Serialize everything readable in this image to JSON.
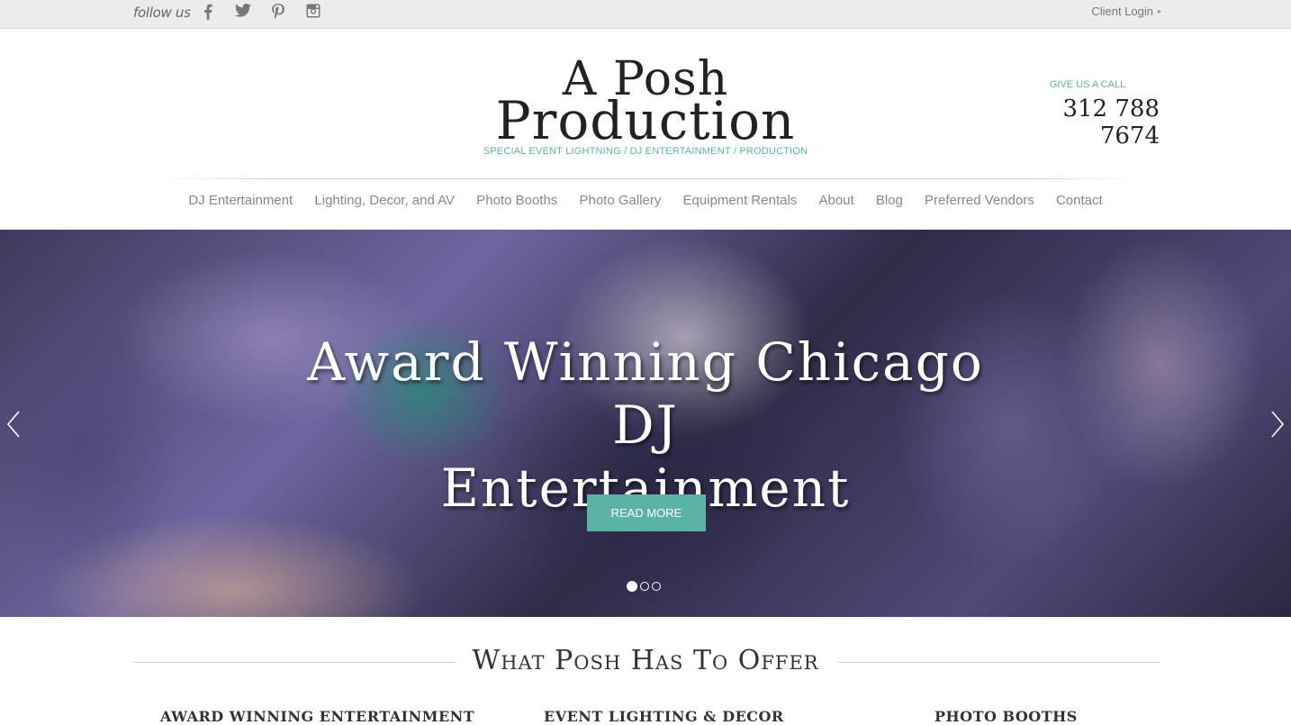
{
  "topbar": {
    "follow_label": "follow us",
    "social": [
      {
        "name": "facebook",
        "icon": "facebook-icon"
      },
      {
        "name": "twitter",
        "icon": "twitter-icon"
      },
      {
        "name": "pinterest",
        "icon": "pinterest-icon"
      },
      {
        "name": "instagram",
        "icon": "instagram-icon"
      }
    ],
    "client_login": "Client Login",
    "client_login_arrow": "▸"
  },
  "header": {
    "logo_line1": "A Posh",
    "logo_line2": "Production",
    "tagline": "SPECIAL EVENT LIGHTNING / DJ ENTERTAINMENT / PRODUCTION",
    "call_label": "GIVE US A CALL",
    "phone": "312 788 7674"
  },
  "nav": {
    "items": [
      {
        "label": "DJ Entertainment"
      },
      {
        "label": "Lighting, Decor, and AV"
      },
      {
        "label": "Photo Booths"
      },
      {
        "label": "Photo Gallery"
      },
      {
        "label": "Equipment Rentals"
      },
      {
        "label": "About"
      },
      {
        "label": "Blog"
      },
      {
        "label": "Preferred Vendors"
      },
      {
        "label": "Contact"
      }
    ]
  },
  "hero": {
    "title": "Award Winning Chicago DJ Entertainment",
    "button": "READ MORE",
    "slides_total": 3,
    "active_slide": 1
  },
  "section": {
    "title": "What Posh Has To Offer",
    "offers": [
      {
        "label": "AWARD WINNING ENTERTAINMENT"
      },
      {
        "label": "EVENT LIGHTING & DECOR"
      },
      {
        "label": "PHOTO BOOTHS"
      }
    ]
  },
  "colors": {
    "accent": "#5bb3a5",
    "topbar_bg": "#ececec",
    "nav_text": "#888888"
  }
}
